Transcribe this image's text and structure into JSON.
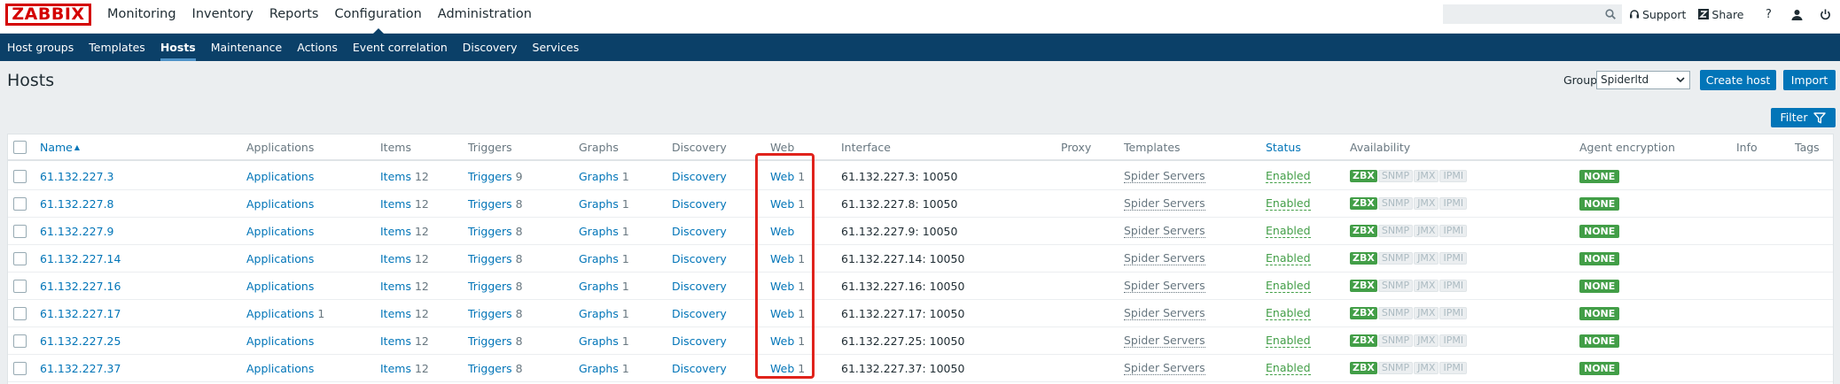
{
  "app": {
    "logo": "ZABBIX",
    "main_menu": [
      "Monitoring",
      "Inventory",
      "Reports",
      "Configuration",
      "Administration"
    ],
    "active_main": "Configuration",
    "search": {
      "value": "",
      "placeholder": ""
    },
    "support_label": "Support",
    "share_label": "Share",
    "help_label": "?"
  },
  "sub_menu": [
    "Host groups",
    "Templates",
    "Hosts",
    "Maintenance",
    "Actions",
    "Event correlation",
    "Discovery",
    "Services"
  ],
  "active_sub": "Hosts",
  "page": {
    "title": "Hosts",
    "group_label": "Group",
    "group_value": "Spiderltd",
    "create_host_label": "Create host",
    "import_label": "Import",
    "filter_label": "Filter"
  },
  "table": {
    "headers": {
      "name": "Name",
      "applications": "Applications",
      "items": "Items",
      "triggers": "Triggers",
      "graphs": "Graphs",
      "discovery": "Discovery",
      "web": "Web",
      "interface": "Interface",
      "proxy": "Proxy",
      "templates": "Templates",
      "status": "Status",
      "availability": "Availability",
      "agent_encryption": "Agent encryption",
      "info": "Info",
      "tags": "Tags"
    },
    "sort_arrow": "▲",
    "rows": [
      {
        "name": "61.132.227.3",
        "applications": "Applications",
        "applications_count": "",
        "items": "Items",
        "items_count": "12",
        "triggers": "Triggers",
        "triggers_count": "9",
        "graphs": "Graphs",
        "graphs_count": "1",
        "discovery": "Discovery",
        "web": "Web",
        "web_count": "1",
        "interface_ip": "61.132.227.3:",
        "interface_port": "10050",
        "templates": "Spider Servers",
        "status": "Enabled",
        "encryption": "NONE"
      },
      {
        "name": "61.132.227.8",
        "applications": "Applications",
        "applications_count": "",
        "items": "Items",
        "items_count": "12",
        "triggers": "Triggers",
        "triggers_count": "8",
        "graphs": "Graphs",
        "graphs_count": "1",
        "discovery": "Discovery",
        "web": "Web",
        "web_count": "1",
        "interface_ip": "61.132.227.8:",
        "interface_port": "10050",
        "templates": "Spider Servers",
        "status": "Enabled",
        "encryption": "NONE"
      },
      {
        "name": "61.132.227.9",
        "applications": "Applications",
        "applications_count": "",
        "items": "Items",
        "items_count": "12",
        "triggers": "Triggers",
        "triggers_count": "8",
        "graphs": "Graphs",
        "graphs_count": "1",
        "discovery": "Discovery",
        "web": "Web",
        "web_count": "",
        "interface_ip": "61.132.227.9:",
        "interface_port": "10050",
        "templates": "Spider Servers",
        "status": "Enabled",
        "encryption": "NONE"
      },
      {
        "name": "61.132.227.14",
        "applications": "Applications",
        "applications_count": "",
        "items": "Items",
        "items_count": "12",
        "triggers": "Triggers",
        "triggers_count": "8",
        "graphs": "Graphs",
        "graphs_count": "1",
        "discovery": "Discovery",
        "web": "Web",
        "web_count": "1",
        "interface_ip": "61.132.227.14:",
        "interface_port": "10050",
        "templates": "Spider Servers",
        "status": "Enabled",
        "encryption": "NONE"
      },
      {
        "name": "61.132.227.16",
        "applications": "Applications",
        "applications_count": "",
        "items": "Items",
        "items_count": "12",
        "triggers": "Triggers",
        "triggers_count": "8",
        "graphs": "Graphs",
        "graphs_count": "1",
        "discovery": "Discovery",
        "web": "Web",
        "web_count": "1",
        "interface_ip": "61.132.227.16:",
        "interface_port": "10050",
        "templates": "Spider Servers",
        "status": "Enabled",
        "encryption": "NONE"
      },
      {
        "name": "61.132.227.17",
        "applications": "Applications",
        "applications_count": "1",
        "items": "Items",
        "items_count": "12",
        "triggers": "Triggers",
        "triggers_count": "8",
        "graphs": "Graphs",
        "graphs_count": "1",
        "discovery": "Discovery",
        "web": "Web",
        "web_count": "1",
        "interface_ip": "61.132.227.17:",
        "interface_port": "10050",
        "templates": "Spider Servers",
        "status": "Enabled",
        "encryption": "NONE"
      },
      {
        "name": "61.132.227.25",
        "applications": "Applications",
        "applications_count": "",
        "items": "Items",
        "items_count": "12",
        "triggers": "Triggers",
        "triggers_count": "8",
        "graphs": "Graphs",
        "graphs_count": "1",
        "discovery": "Discovery",
        "web": "Web",
        "web_count": "1",
        "interface_ip": "61.132.227.25:",
        "interface_port": "10050",
        "templates": "Spider Servers",
        "status": "Enabled",
        "encryption": "NONE"
      },
      {
        "name": "61.132.227.37",
        "applications": "Applications",
        "applications_count": "",
        "items": "Items",
        "items_count": "12",
        "triggers": "Triggers",
        "triggers_count": "8",
        "graphs": "Graphs",
        "graphs_count": "1",
        "discovery": "Discovery",
        "web": "Web",
        "web_count": "1",
        "interface_ip": "61.132.227.37:",
        "interface_port": "10050",
        "templates": "Spider Servers",
        "status": "Enabled",
        "encryption": "NONE"
      }
    ],
    "availability_badges": [
      "ZBX",
      "SNMP",
      "JMX",
      "IPMI"
    ]
  },
  "colors": {
    "brand_red": "#d40000",
    "nav_blue": "#0b4068",
    "link_blue": "#0275b8",
    "enabled_green": "#429e47",
    "highlight_red": "#e0231c"
  }
}
